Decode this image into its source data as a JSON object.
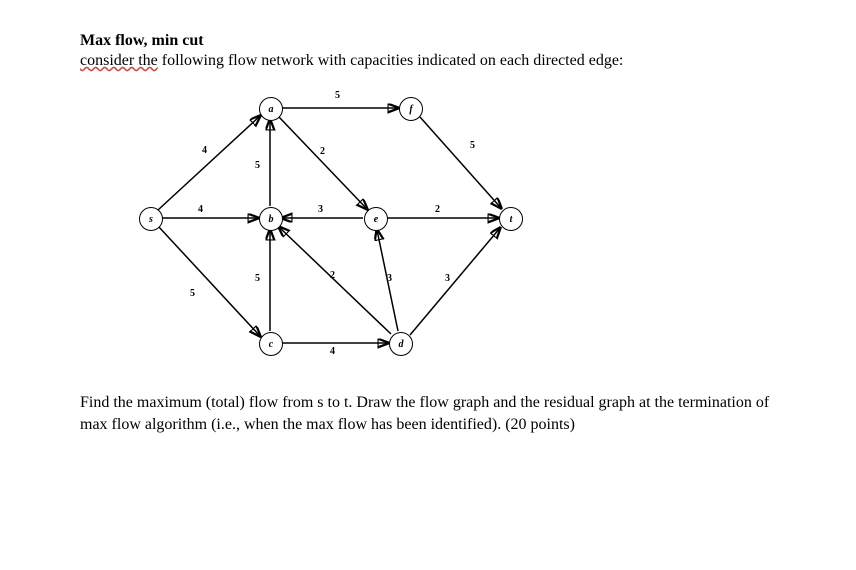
{
  "title": "Max flow, min cut",
  "subtitle_wavy": "consider the",
  "subtitle_rest": " following flow network with capacities indicated on each directed edge:",
  "nodes": {
    "s": "s",
    "a": "a",
    "b": "b",
    "c": "c",
    "d": "d",
    "e": "e",
    "f": "f",
    "t": "t"
  },
  "edges": {
    "s_a": "4",
    "s_b": "4",
    "s_c": "5",
    "b_a": "5",
    "c_b": "5",
    "a_f": "5",
    "a_e": "2",
    "e_b": "3",
    "c_d": "4",
    "d_b": "2",
    "d_e": "3",
    "d_t": "3",
    "f_t": "5",
    "e_t": "2"
  },
  "question": "Find the maximum (total) flow from s to t. Draw the flow graph and the residual graph at the termination of max flow algorithm (i.e., when the max flow has been identified). (20 points)"
}
